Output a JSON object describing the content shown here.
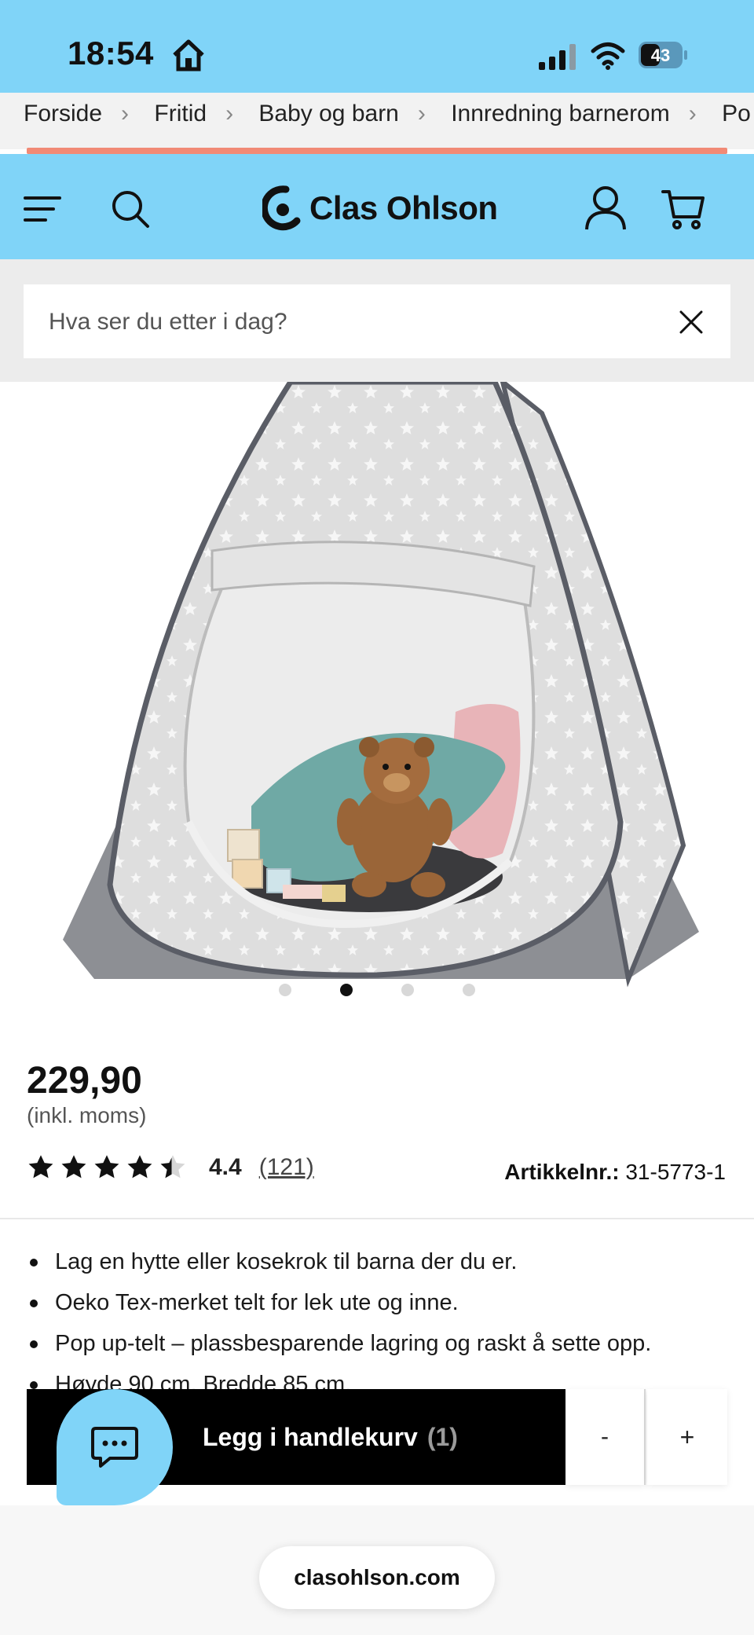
{
  "status_bar": {
    "time": "18:54",
    "battery": "43"
  },
  "breadcrumb": [
    "Forside",
    "Fritid",
    "Baby og barn",
    "Innredning barnerom",
    "Po"
  ],
  "header": {
    "logo_text": "Clas Ohlson"
  },
  "search": {
    "placeholder": "Hva ser du etter i dag?"
  },
  "carousel": {
    "count": 4,
    "active_index": 1
  },
  "product": {
    "price": "229,90",
    "price_note": "(inkl. moms)",
    "rating": 4.4,
    "rating_label": "4.4",
    "review_count": "(121)",
    "article_label": "Artikkelnr.:",
    "article_number": "31-5773-1",
    "features": [
      "Lag en hytte eller kosekrok til barna der du er.",
      "Oeko Tex-merket telt for lek ute og inne.",
      "Pop up-telt – plassbesparende lagring og raskt å sette opp.",
      "Høyde 90 cm. Bredde 85 cm."
    ]
  },
  "cart_bar": {
    "add_label": "Legg i handlekurv",
    "count": "(1)",
    "minus": "-",
    "plus": "+"
  },
  "browser": {
    "url": "clasohlson.com"
  },
  "colors": {
    "brand_blue": "#80d4f8",
    "promo": "#f18a76",
    "cart_bar": "#000000"
  }
}
